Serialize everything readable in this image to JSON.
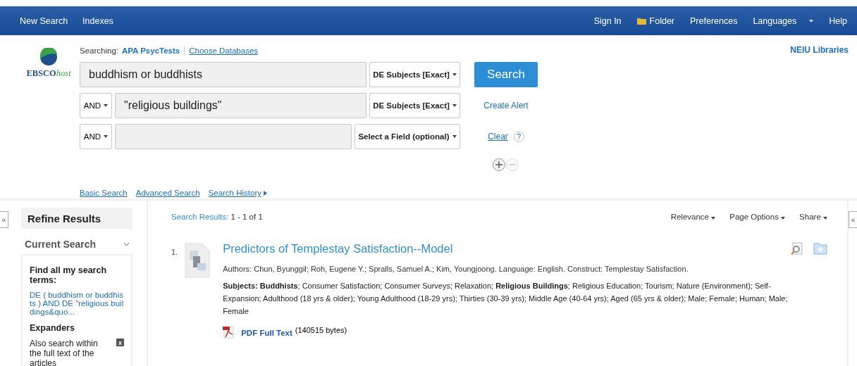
{
  "top_nav": {
    "left": [
      {
        "label": "New Search"
      },
      {
        "label": "Indexes"
      }
    ],
    "right": [
      {
        "label": "Sign In",
        "kind": "link"
      },
      {
        "label": "Folder",
        "kind": "folder"
      },
      {
        "label": "Preferences",
        "kind": "link"
      },
      {
        "label": "Languages",
        "kind": "dropdown"
      },
      {
        "label": "Help",
        "kind": "link"
      }
    ]
  },
  "logo": {
    "brand": "EBSCO",
    "suffix": "host"
  },
  "searching": {
    "label": "Searching:",
    "database": "APA PsycTests",
    "choose": "Choose Databases"
  },
  "institution": "NEIU Libraries",
  "search_rows": [
    {
      "operator": null,
      "value": "buddhism or buddhists",
      "field": "DE Subjects [Exact]"
    },
    {
      "operator": "AND",
      "value": "\"religious buildings\"",
      "field": "DE Subjects [Exact]"
    },
    {
      "operator": "AND",
      "value": "",
      "field": "Select a Field (optional)"
    }
  ],
  "search_button": "Search",
  "create_alert": "Create Alert",
  "clear": "Clear",
  "help_mark": "?",
  "links": [
    {
      "label": "Basic Search"
    },
    {
      "label": "Advanced Search"
    },
    {
      "label": "Search History",
      "caret": true
    }
  ],
  "collapse_glyph": "«",
  "sidebar": {
    "title": "Refine Results",
    "section": "Current Search",
    "find_all": "Find all my search terms:",
    "query": "DE ( buddhism or buddhists ) AND DE \"religious buildings&quo...",
    "expanders": "Expanders",
    "expander_item": "Also search within the full text of the articles",
    "remove_glyph": "x"
  },
  "results": {
    "label": "Search Results:",
    "range": "1 - 1 of 1",
    "tools": [
      "Relevance",
      "Page Options",
      "Share"
    ],
    "items": [
      {
        "number": "1.",
        "title": "Predictors of Templestay Satisfaction--Model",
        "meta": "Authors: Chun, Byunggil; Roh, Eugene Y.; Spralls, Samuel A.; Kim, Youngjoong. Language: English. Construct: Templestay Satisfaction.",
        "subjects": "**Subjects: Buddhists**; Consumer Satisfaction; Consumer Surveys; Relaxation; **Religious Buildings**; Religious Education; Tourism; Nature (Environment); Self-Expansion; Adulthood (18 yrs & older); Young Adulthood (18-29 yrs); Thirties (30-39 yrs); Middle Age (40-64 yrs); Aged (65 yrs & older); Male; Female; Human; Male; Female",
        "pdf_label": "PDF Full Text",
        "pdf_size": "(140515 bytes)"
      }
    ]
  }
}
